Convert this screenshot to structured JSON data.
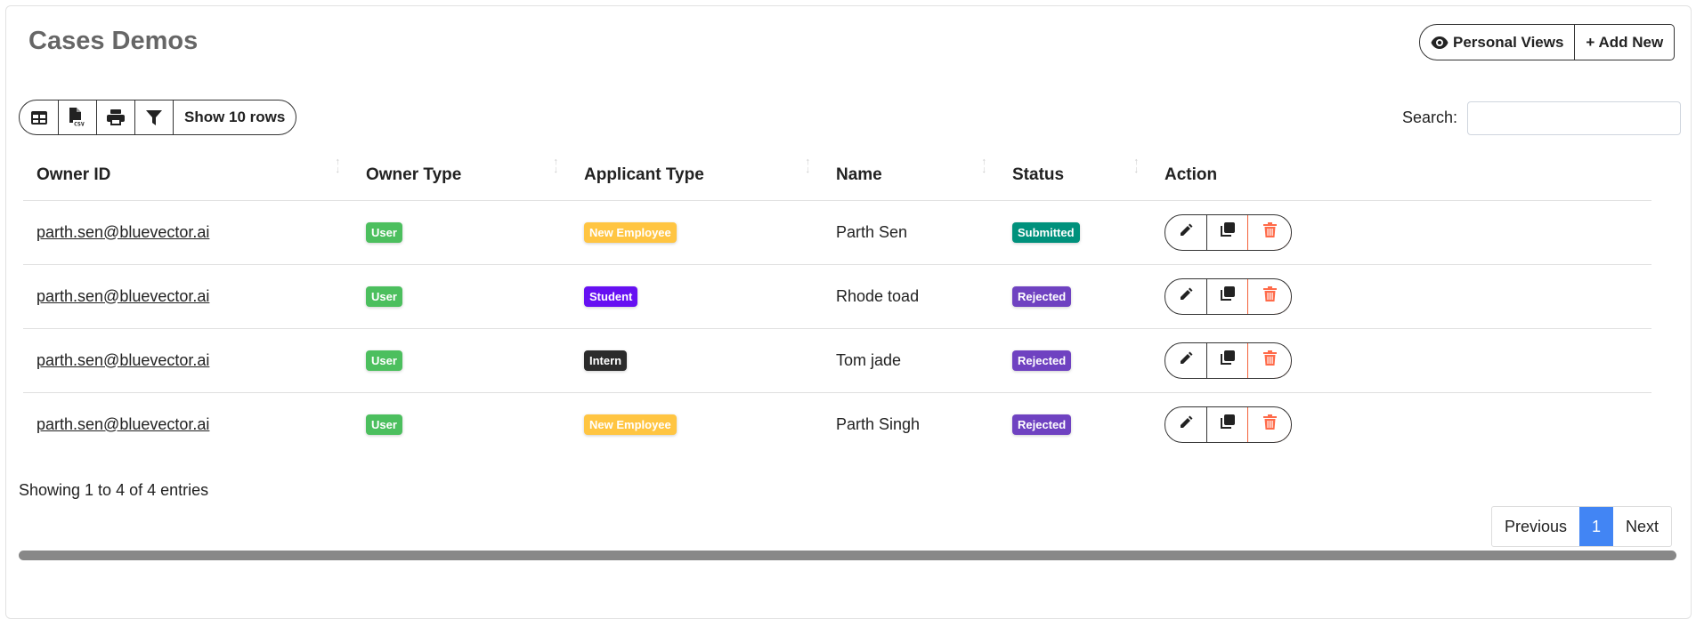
{
  "header": {
    "title": "Cases Demos",
    "personal_views": "Personal Views",
    "add_new": "+ Add New"
  },
  "toolbar": {
    "show_rows": "Show 10 rows",
    "icons": [
      "table-icon",
      "csv-icon",
      "print-icon",
      "filter-icon"
    ]
  },
  "search": {
    "label": "Search:",
    "value": "",
    "placeholder": ""
  },
  "table": {
    "columns": [
      "Owner ID",
      "Owner Type",
      "Applicant Type",
      "Name",
      "Status",
      "Action"
    ],
    "rows": [
      {
        "owner_id": "parth.sen@bluevector.ai",
        "owner_type": "User",
        "applicant_type": "New Employee",
        "name": "Parth Sen",
        "status": "Submitted"
      },
      {
        "owner_id": "parth.sen@bluevector.ai",
        "owner_type": "User",
        "applicant_type": "Student",
        "name": "Rhode toad",
        "status": "Rejected"
      },
      {
        "owner_id": "parth.sen@bluevector.ai",
        "owner_type": "User",
        "applicant_type": "Intern",
        "name": "Tom jade",
        "status": "Rejected"
      },
      {
        "owner_id": "parth.sen@bluevector.ai",
        "owner_type": "User",
        "applicant_type": "New Employee",
        "name": "Parth Singh",
        "status": "Rejected"
      }
    ]
  },
  "badge_colors": {
    "User": "#4cbf5e",
    "New Employee": "#ffc542",
    "Student": "#6610f2",
    "Intern": "#2b2b2b",
    "Submitted": "#00917c",
    "Rejected": "#6f42c1"
  },
  "footer": {
    "info": "Showing 1 to 4 of 4 entries",
    "previous": "Previous",
    "page": "1",
    "next": "Next"
  }
}
